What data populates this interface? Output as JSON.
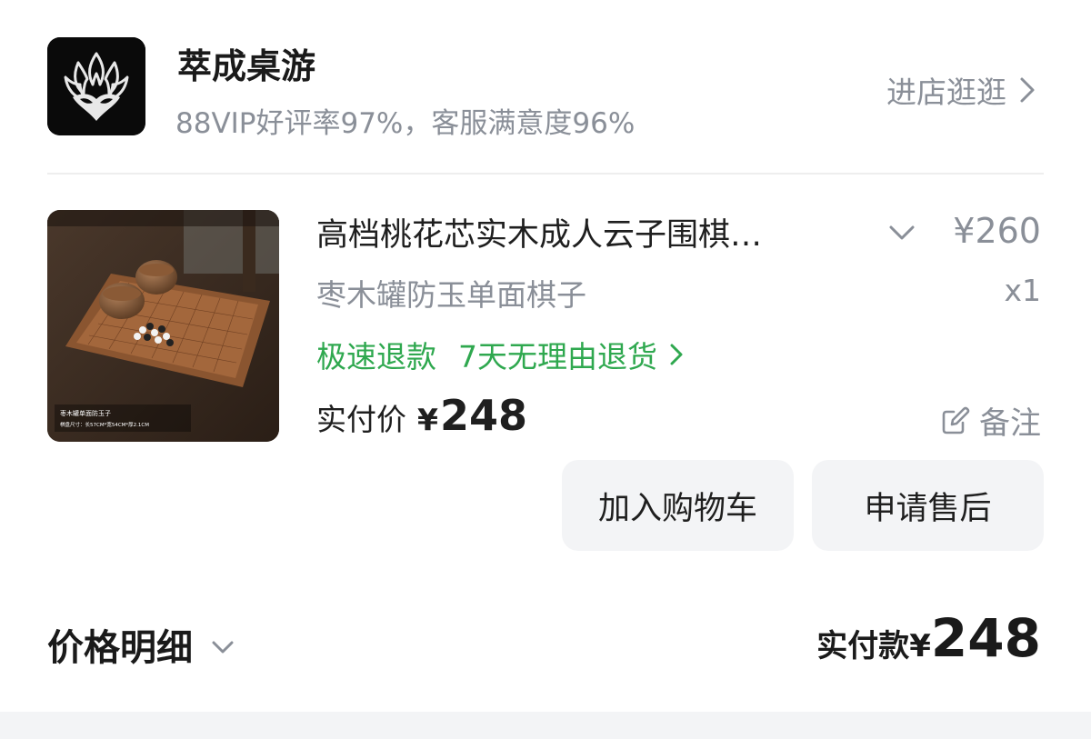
{
  "shop": {
    "name": "萃成桌游",
    "stats": "88VIP好评率97%，客服满意度96%",
    "visit_label": "进店逛逛"
  },
  "product": {
    "title": "高档桃花芯实木成人云子围棋…",
    "spec": "枣木罐防玉单面棋子",
    "price": "¥260",
    "quantity": "x1",
    "service_tags": [
      "极速退款",
      "7天无理由退货"
    ],
    "paid_label": "实付价",
    "paid_currency": "¥",
    "paid_amount": "248",
    "remark_label": "备注",
    "thumb_caption_line1": "枣木罐单面防玉子",
    "thumb_caption_line2": "棋盘尺寸：长57CM*宽54CM*厚2.1CM"
  },
  "actions": {
    "add_to_cart": "加入购物车",
    "after_sale": "申请售后"
  },
  "summary": {
    "price_detail_label": "价格明细",
    "total_label": "实付款",
    "total_currency": "¥",
    "total_amount": "248"
  },
  "colors": {
    "accent_green": "#2fa84f",
    "muted_text": "#8a8f98",
    "button_bg": "#f3f4f6"
  }
}
